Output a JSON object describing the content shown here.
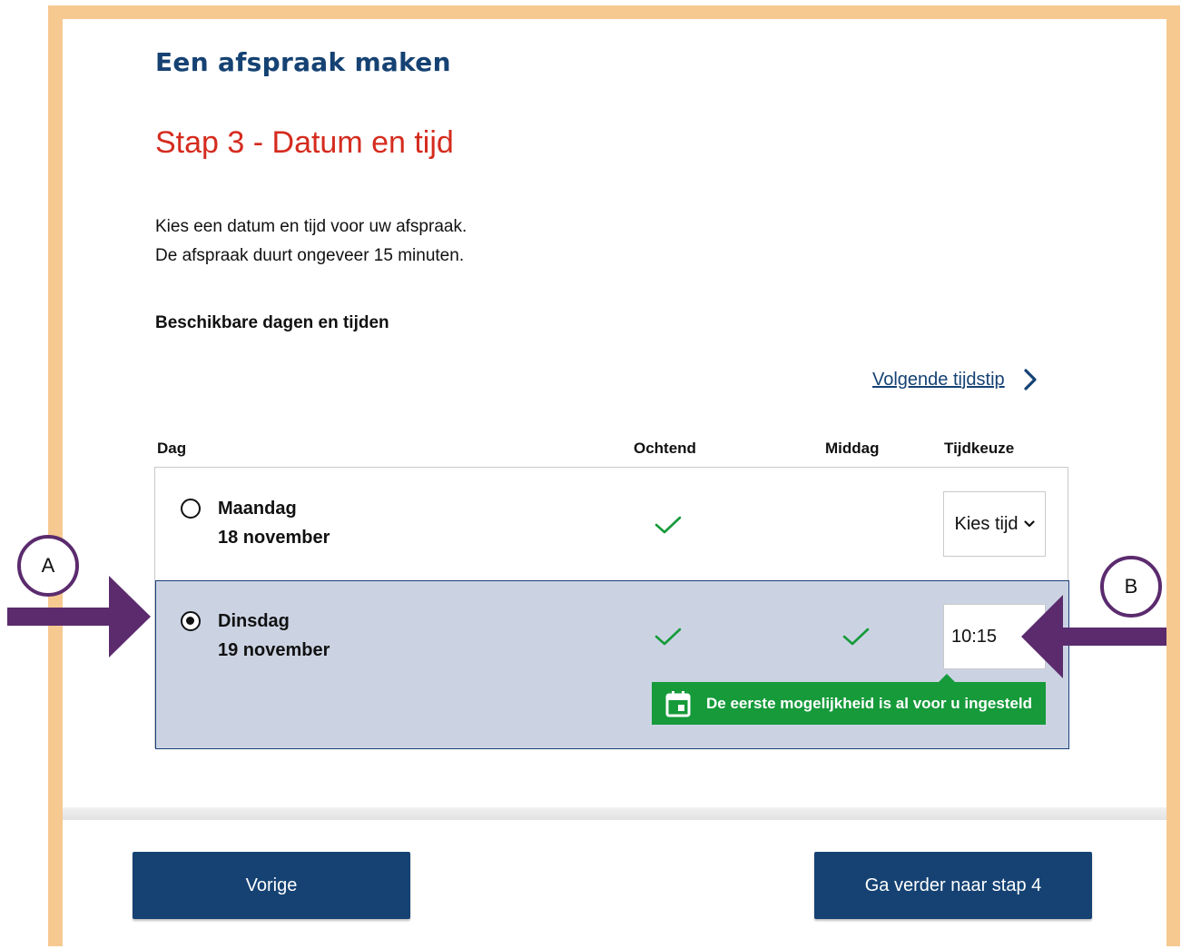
{
  "header": {
    "brand": "Een afspraak maken"
  },
  "step": {
    "title": "Stap 3 - Datum en tijd"
  },
  "intro": {
    "line1": "Kies een datum en tijd voor uw afspraak.",
    "line2": "De afspraak duurt ongeveer 15 minuten."
  },
  "section": {
    "heading": "Beschikbare dagen en tijden"
  },
  "nav": {
    "next_time_label": "Volgende tijdstip",
    "next_icon": "chevron-right-icon"
  },
  "table": {
    "columns": {
      "day": "Dag",
      "morning": "Ochtend",
      "afternoon": "Middag",
      "time": "Tijdkeuze"
    },
    "rows": [
      {
        "day": "Maandag",
        "date": "18 november",
        "selected": false,
        "morning_available": true,
        "afternoon_available": false,
        "time_label": "Kies tijd"
      },
      {
        "day": "Dinsdag",
        "date": "19 november",
        "selected": true,
        "morning_available": true,
        "afternoon_available": true,
        "time_value": "10:15"
      }
    ],
    "tooltip": {
      "text": "De eerste mogelijkheid is al voor u ingesteld",
      "icon": "calendar-icon"
    }
  },
  "footer": {
    "prev_label": "Vorige",
    "next_label": "Ga verder naar stap 4"
  },
  "annotations": {
    "marker_a": "A",
    "marker_b": "B"
  },
  "colors": {
    "frame": "#f6c991",
    "brand_blue": "#154273",
    "title_red": "#d52b1e",
    "selected_row": "#cbd3e3",
    "success_green": "#169a3a",
    "annotation_purple": "#5b2b6e"
  }
}
